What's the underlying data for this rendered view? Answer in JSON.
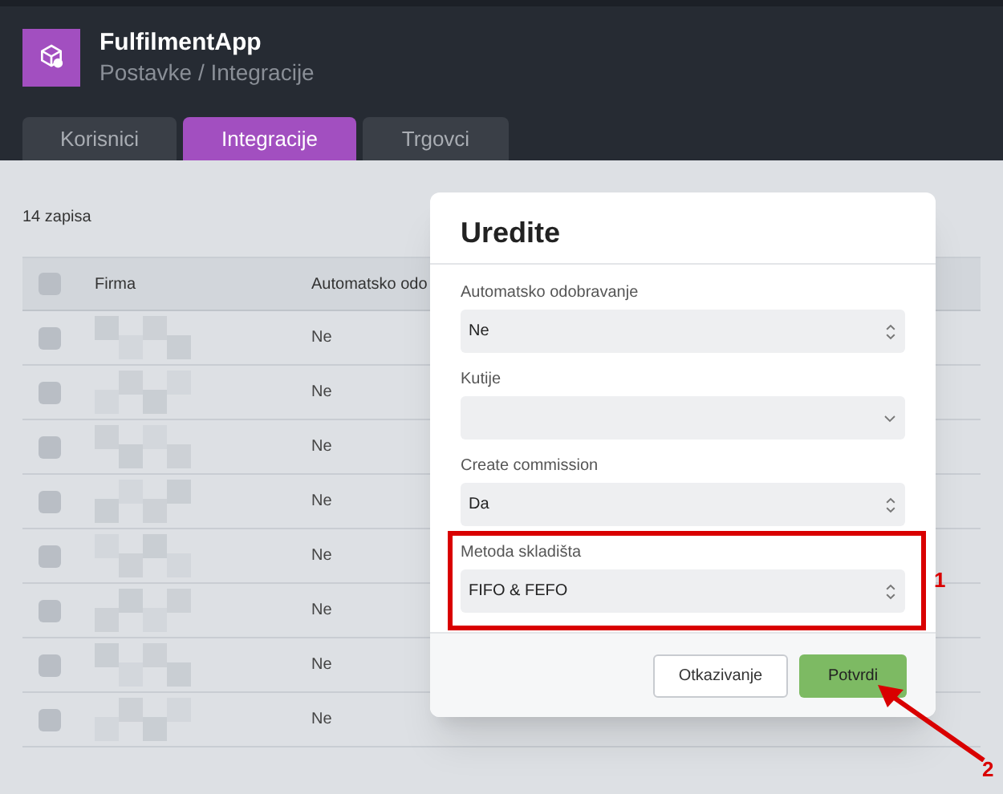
{
  "app": {
    "title": "FulfilmentApp",
    "breadcrumb": "Postavke / Integracije"
  },
  "tabs": [
    {
      "label": "Korisnici",
      "selected": false
    },
    {
      "label": "Integracije",
      "selected": true
    },
    {
      "label": "Trgovci",
      "selected": false
    }
  ],
  "record_count": "14 zapisa",
  "table": {
    "all_checked": false,
    "columns": [
      "Firma",
      "Automatsko odo"
    ],
    "rows": [
      {
        "checked": false,
        "column_2": "Ne"
      },
      {
        "checked": false,
        "column_2": "Ne"
      },
      {
        "checked": false,
        "column_2": "Ne"
      },
      {
        "checked": false,
        "column_2": "Ne"
      },
      {
        "checked": false,
        "column_2": "Ne"
      },
      {
        "checked": false,
        "column_2": "Ne"
      },
      {
        "checked": false,
        "column_2": "Ne"
      },
      {
        "checked": false,
        "column_2": "Ne"
      }
    ]
  },
  "dialog": {
    "title": "Uredite",
    "fields": [
      {
        "label": "Automatsko odobravanje",
        "value": "Ne",
        "kind": "stepper"
      },
      {
        "label": "Kutije",
        "kind": "dropdown"
      },
      {
        "label": "Create commission",
        "value": "Da",
        "kind": "stepper"
      },
      {
        "label": "Metoda skladišta",
        "value": "FIFO & FEFO",
        "kind": "stepper",
        "callout": "1"
      }
    ],
    "buttons": [
      {
        "label": "Otkazivanje",
        "kind": "secondary"
      },
      {
        "label": "Potvrdi",
        "kind": "primary",
        "callout": "2"
      }
    ]
  }
}
